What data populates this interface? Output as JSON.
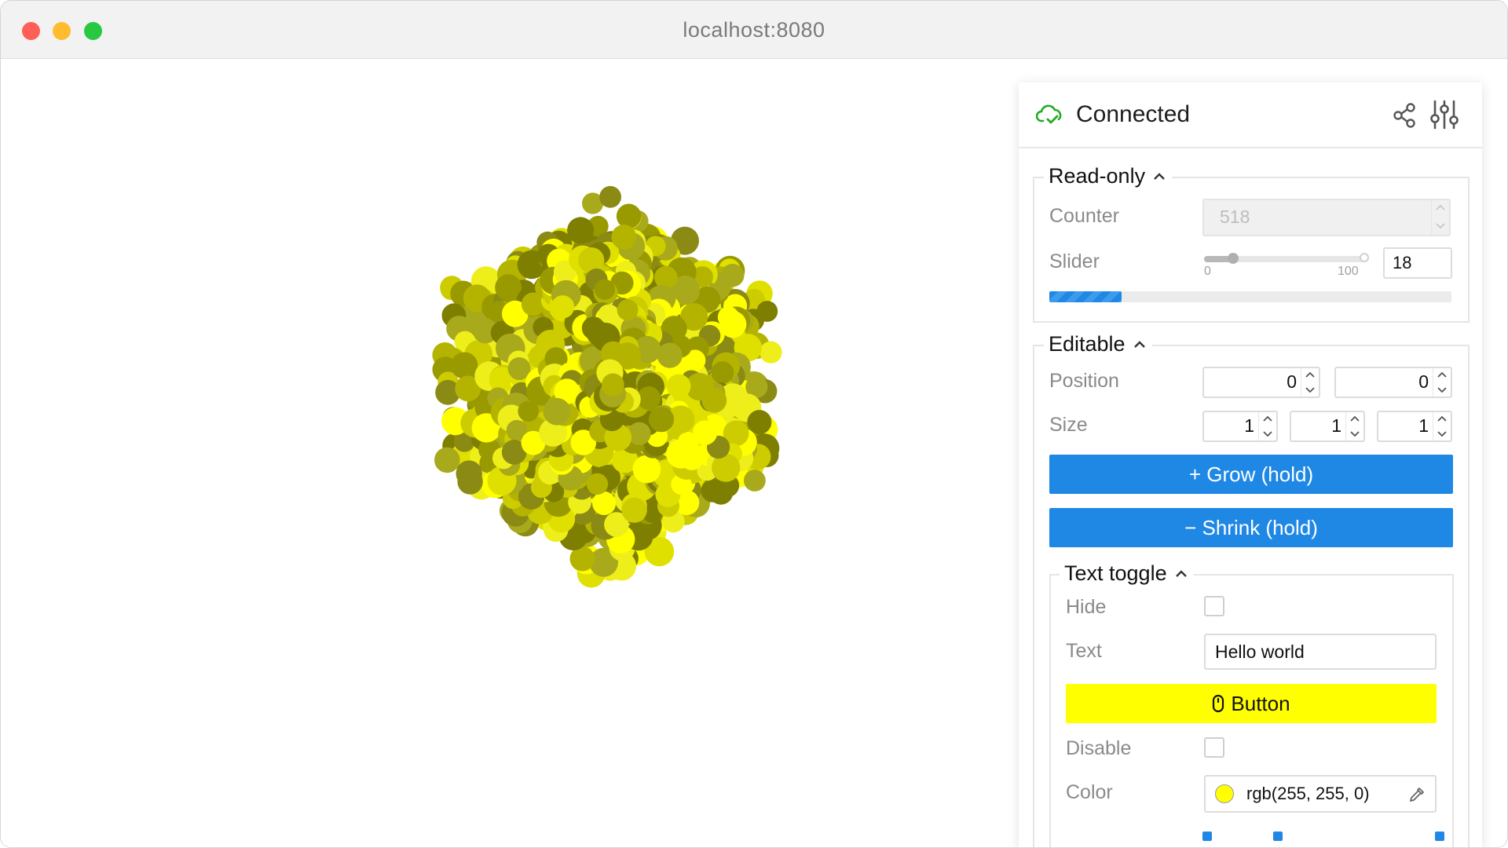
{
  "browser": {
    "url": "localhost:8080"
  },
  "scene": {
    "particle_color": "#e6e600"
  },
  "panel": {
    "status": "Connected",
    "status_color": "#22aa22",
    "icons": [
      "cloud-check-icon",
      "share-icon",
      "sliders-icon"
    ],
    "readonly": {
      "title": "Read-only",
      "counter_label": "Counter",
      "counter_value": "518",
      "slider_label": "Slider",
      "slider_min": "0",
      "slider_max": "100",
      "slider_value": "18",
      "progress_fraction": 0.18
    },
    "editable": {
      "title": "Editable",
      "position_label": "Position",
      "position_values": [
        "0",
        "0"
      ],
      "size_label": "Size",
      "size_values": [
        "1",
        "1",
        "1"
      ],
      "grow_label": "+ Grow (hold)",
      "shrink_label": "− Shrink (hold)"
    },
    "text_toggle": {
      "title": "Text toggle",
      "hide_label": "Hide",
      "text_label": "Text",
      "text_value": "Hello world",
      "button_label": "Button",
      "disable_label": "Disable",
      "color_label": "Color",
      "color_value": "rgb(255, 255, 0)",
      "color_hex": "#ffff00",
      "accent": "#1f88e5"
    }
  }
}
